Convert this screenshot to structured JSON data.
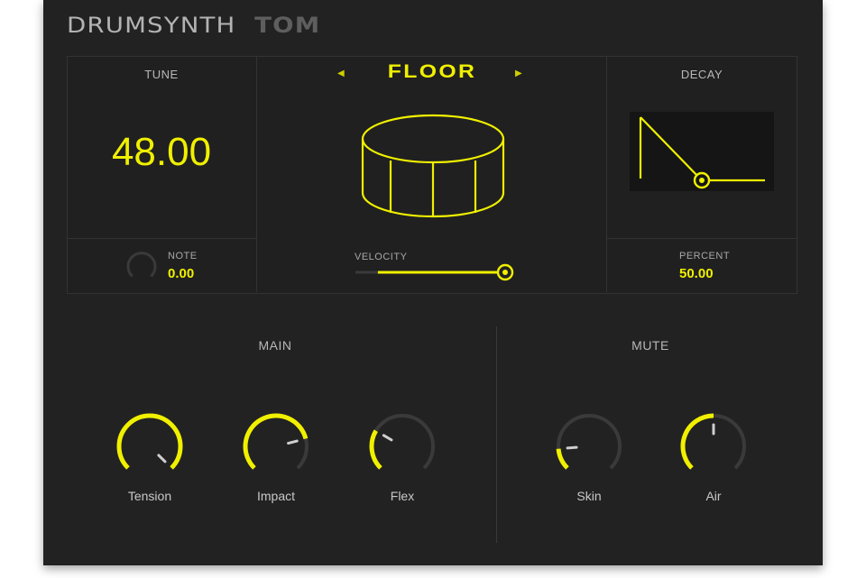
{
  "header": {
    "title": "DRUMSYNTH",
    "subtitle": "TOM"
  },
  "tune": {
    "label": "TUNE",
    "value": "48.00",
    "note_label": "NOTE",
    "note_value": "0.00"
  },
  "preset": {
    "name": "FLOOR",
    "prev_icon": "triangle-left-icon",
    "next_icon": "triangle-right-icon"
  },
  "velocity": {
    "label": "VELOCITY",
    "level": 0.85
  },
  "decay": {
    "label": "DECAY",
    "percent_label": "PERCENT",
    "percent_value": "50.00"
  },
  "main": {
    "label": "MAIN",
    "knobs": [
      {
        "label": "Tension",
        "level": 1.0
      },
      {
        "label": "Impact",
        "level": 0.78
      },
      {
        "label": "Flex",
        "level": 0.28
      }
    ]
  },
  "mute": {
    "label": "MUTE",
    "knobs": [
      {
        "label": "Skin",
        "level": 0.15
      },
      {
        "label": "Air",
        "level": 0.5
      }
    ]
  },
  "colors": {
    "accent": "#f0f000",
    "background": "#222222",
    "track": "#3a3a3a"
  }
}
